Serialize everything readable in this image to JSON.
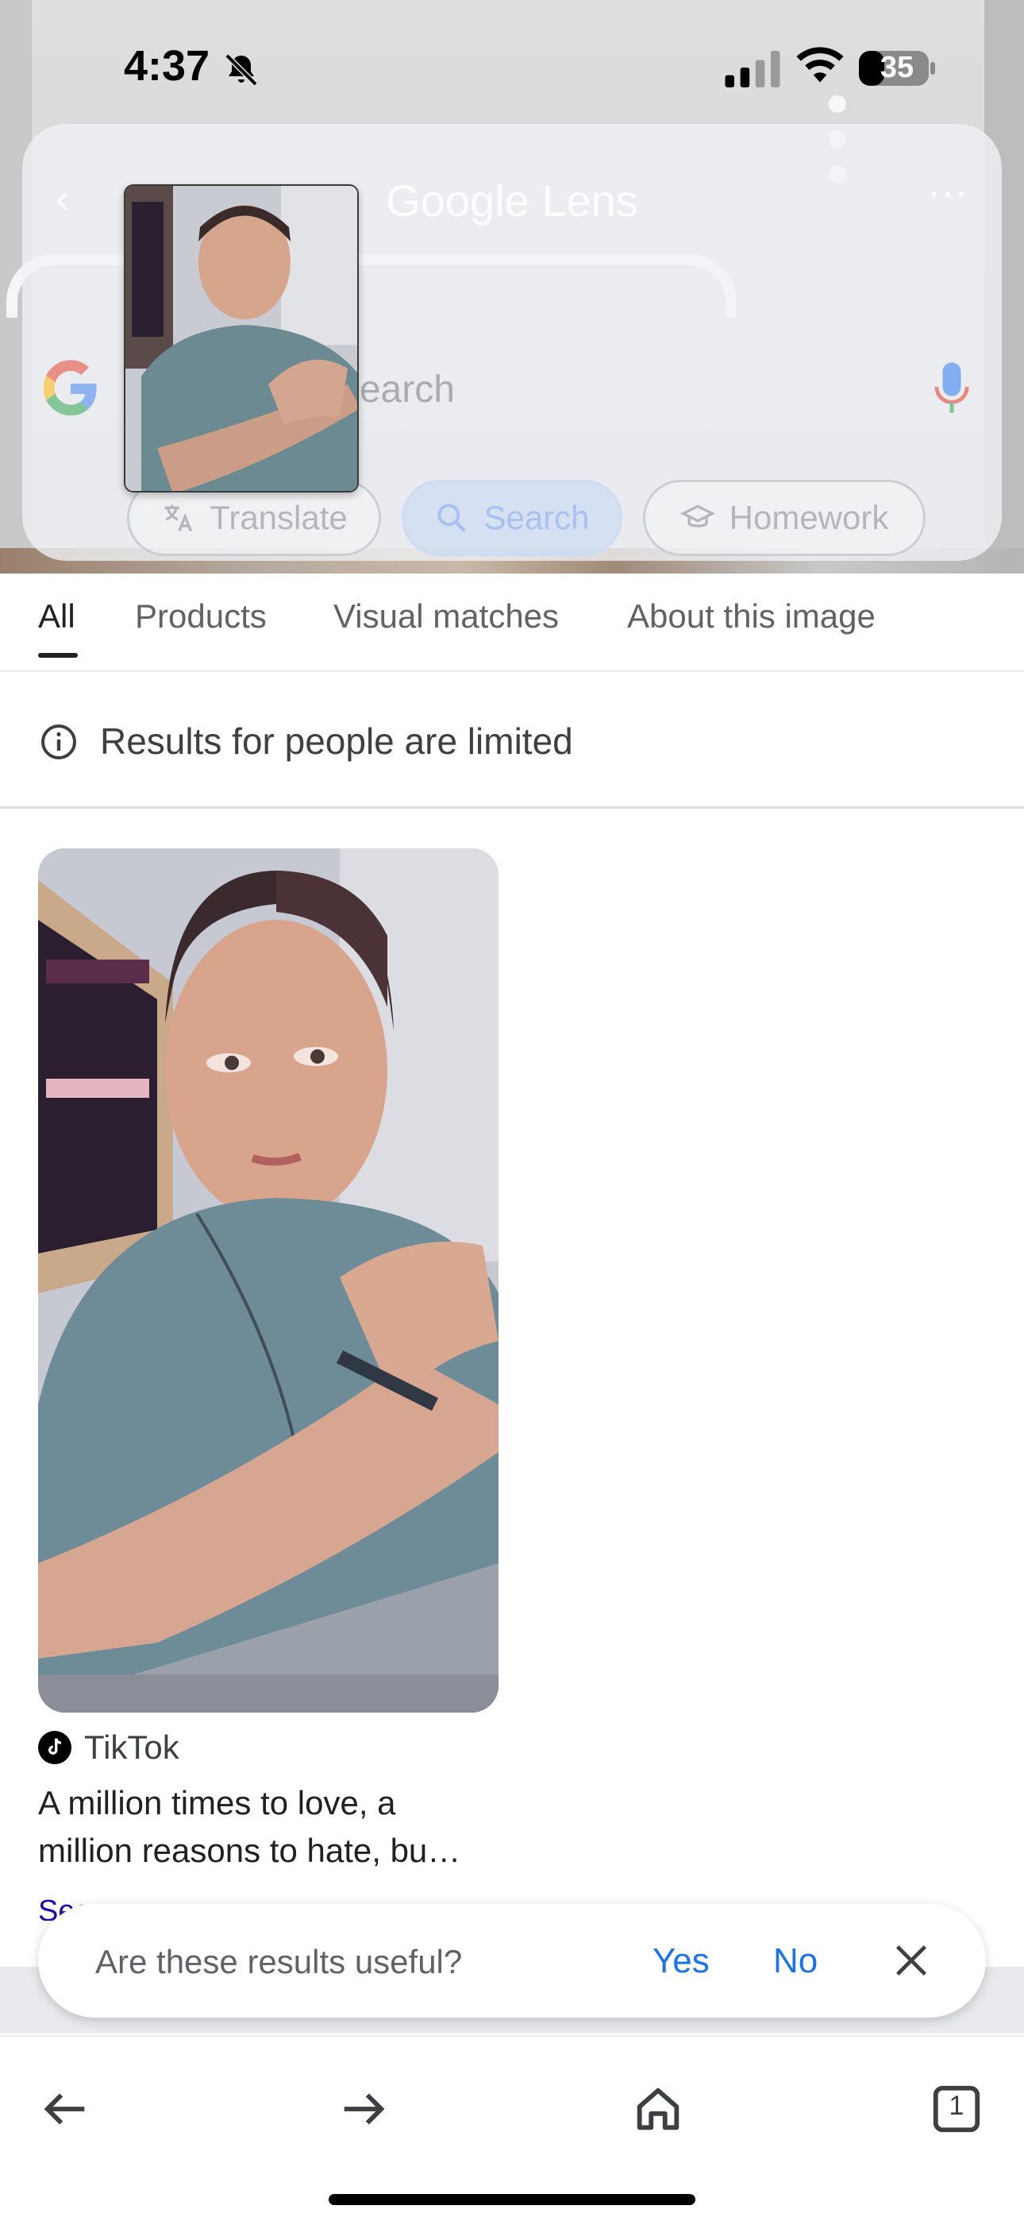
{
  "status_bar": {
    "time": "4:37",
    "battery": "35"
  },
  "lens": {
    "title": "Google Lens",
    "search_placeholder": "Add to your search",
    "chips": {
      "translate": "Translate",
      "search": "Search",
      "homework": "Homework"
    }
  },
  "tabs": {
    "all": "All",
    "products": "Products",
    "visual_matches": "Visual matches",
    "about": "About this image"
  },
  "notice": {
    "text": "Results for people are limited"
  },
  "result": {
    "source": "TikTok",
    "title_line1": "A million times to love, a",
    "title_line2": "million reasons to hate, bu…",
    "more_link": "See more"
  },
  "feedback": {
    "question": "Are these results useful?",
    "yes": "Yes",
    "no": "No"
  },
  "bottom_nav": {
    "tab_count": "1"
  },
  "colors": {
    "accent_blue": "#1a73e8",
    "link_blue": "#1a0dab",
    "text_primary": "#202124",
    "text_secondary": "#5f6368"
  }
}
